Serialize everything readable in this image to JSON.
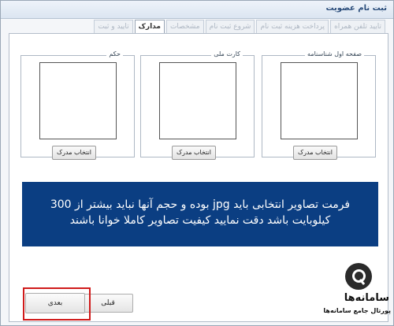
{
  "window": {
    "title": "ثبت نام عضویت"
  },
  "tabs": [
    {
      "label": "تایید تلفن همراه"
    },
    {
      "label": "پرداخت هزینه ثبت نام"
    },
    {
      "label": "شروع ثبت نام"
    },
    {
      "label": "مشخصات"
    },
    {
      "label": "مدارک"
    },
    {
      "label": "تایید و ثبت"
    }
  ],
  "documents": [
    {
      "label": "صفحه اول شناسنامه",
      "button": "انتخاب مدرک"
    },
    {
      "label": "کارت ملی",
      "button": "انتخاب مدرک"
    },
    {
      "label": "حکم",
      "button": "انتخاب مدرک"
    }
  ],
  "notice": {
    "text": "فرمت تصاویر انتخابی باید jpg بوده و حجم آنها نباید بیشتر از 300 کیلوبایت باشد دقت نمایید کیفیت تصاویر کاملا خوانا باشند"
  },
  "nav": {
    "prev_label": "قبلی",
    "next_label": "بعدی"
  },
  "watermark": {
    "brand": "سامانه‌ها",
    "tagline": "پورتال جامع سامانه‌ها"
  },
  "colors": {
    "notice_bg": "#0b3e82",
    "highlight": "#d01a1a"
  }
}
